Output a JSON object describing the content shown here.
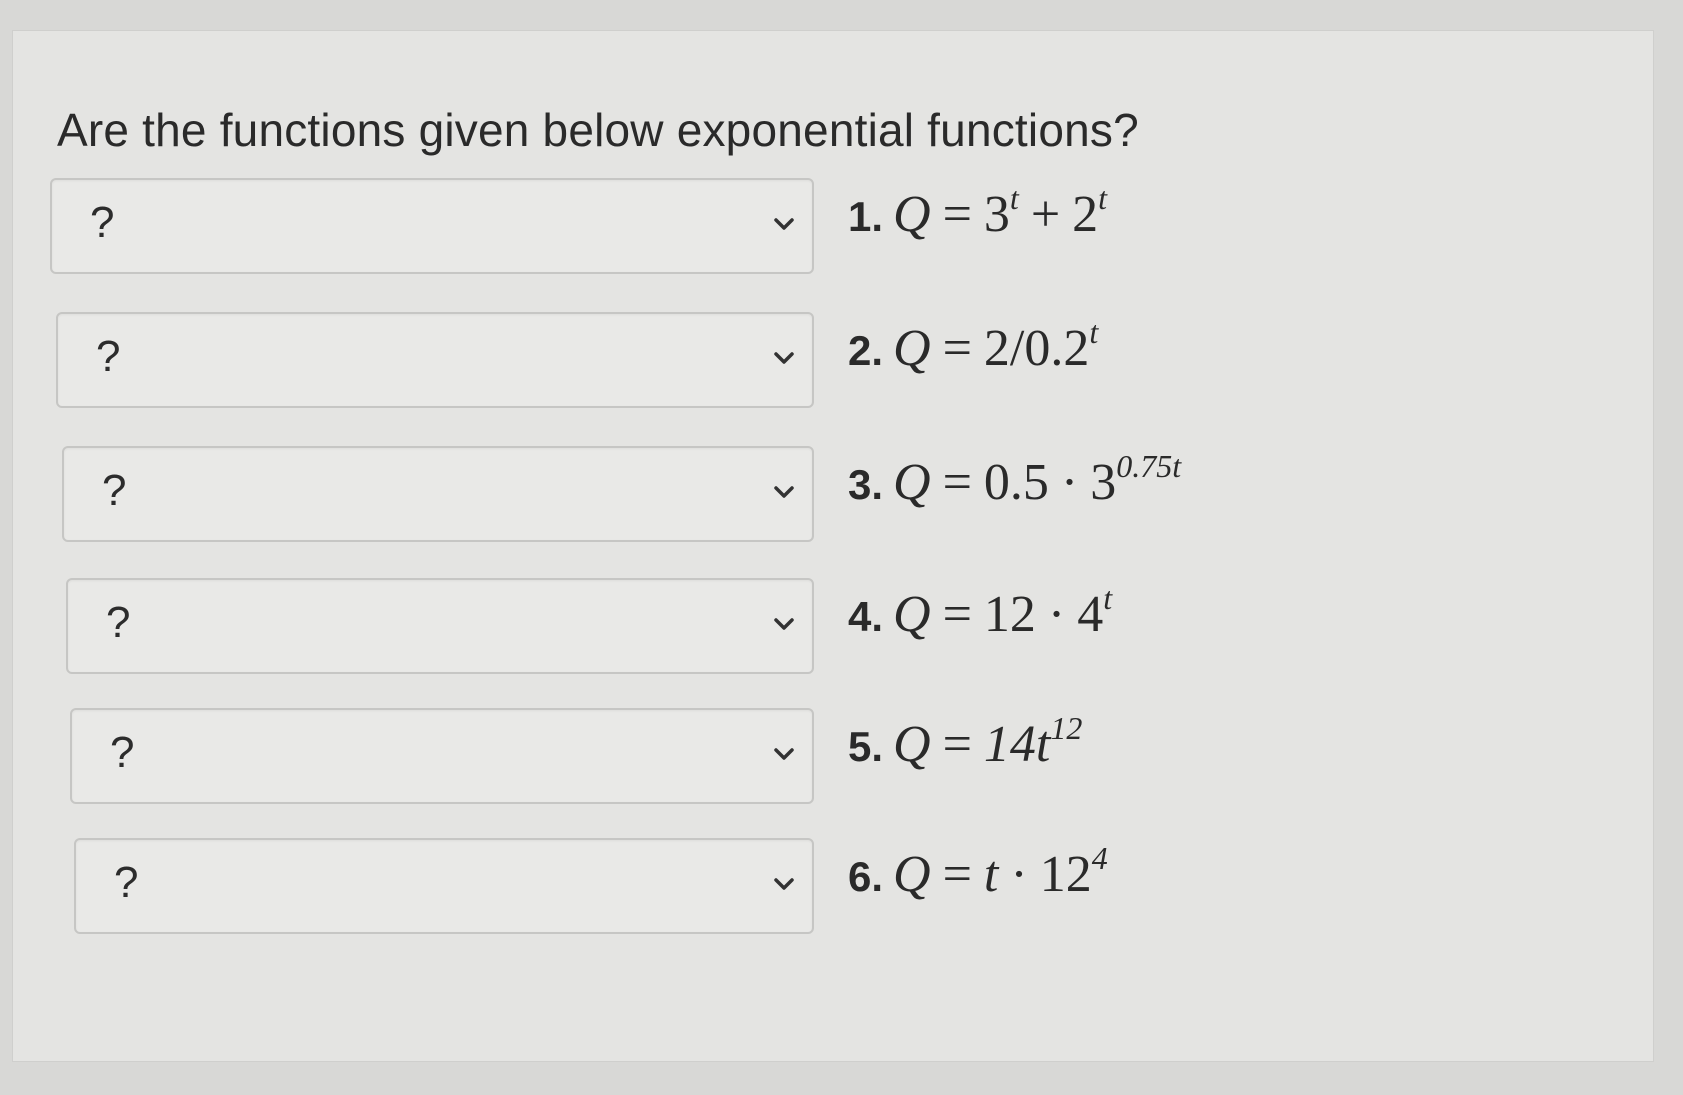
{
  "question": {
    "text": "Are the functions given below exponential functions?"
  },
  "rows": [
    {
      "select_value": "?",
      "number": "1.",
      "lhs": "Q",
      "eq": "=",
      "parts": [
        {
          "base": "3",
          "exp": "t"
        },
        {
          "op": "+"
        },
        {
          "base": "2",
          "exp": "t"
        }
      ]
    },
    {
      "select_value": "?",
      "number": "2.",
      "lhs": "Q",
      "eq": "=",
      "parts": [
        {
          "base": "2/0.2",
          "exp": "t"
        }
      ]
    },
    {
      "select_value": "?",
      "number": "3.",
      "lhs": "Q",
      "eq": "=",
      "parts": [
        {
          "base": "0.5"
        },
        {
          "op": "·"
        },
        {
          "base": "3",
          "exp": "0.75t"
        }
      ]
    },
    {
      "select_value": "?",
      "number": "4.",
      "lhs": "Q",
      "eq": "=",
      "parts": [
        {
          "base": "12"
        },
        {
          "op": "·"
        },
        {
          "base": "4",
          "exp": "t"
        }
      ]
    },
    {
      "select_value": "?",
      "number": "5.",
      "lhs": "Q",
      "eq": "=",
      "parts": [
        {
          "base": "14t",
          "exp": "12"
        }
      ]
    },
    {
      "select_value": "?",
      "number": "6.",
      "lhs": "Q",
      "eq": "=",
      "parts": [
        {
          "base": "t"
        },
        {
          "op": "·"
        },
        {
          "base": "12",
          "exp": "4"
        }
      ]
    }
  ],
  "icons": {
    "dropdown": "chevron-down-icon"
  },
  "colors": {
    "background": "#d8d8d6",
    "panel": "#e4e4e2",
    "select_border": "#c6c6c4",
    "text": "#2a2a2a"
  }
}
